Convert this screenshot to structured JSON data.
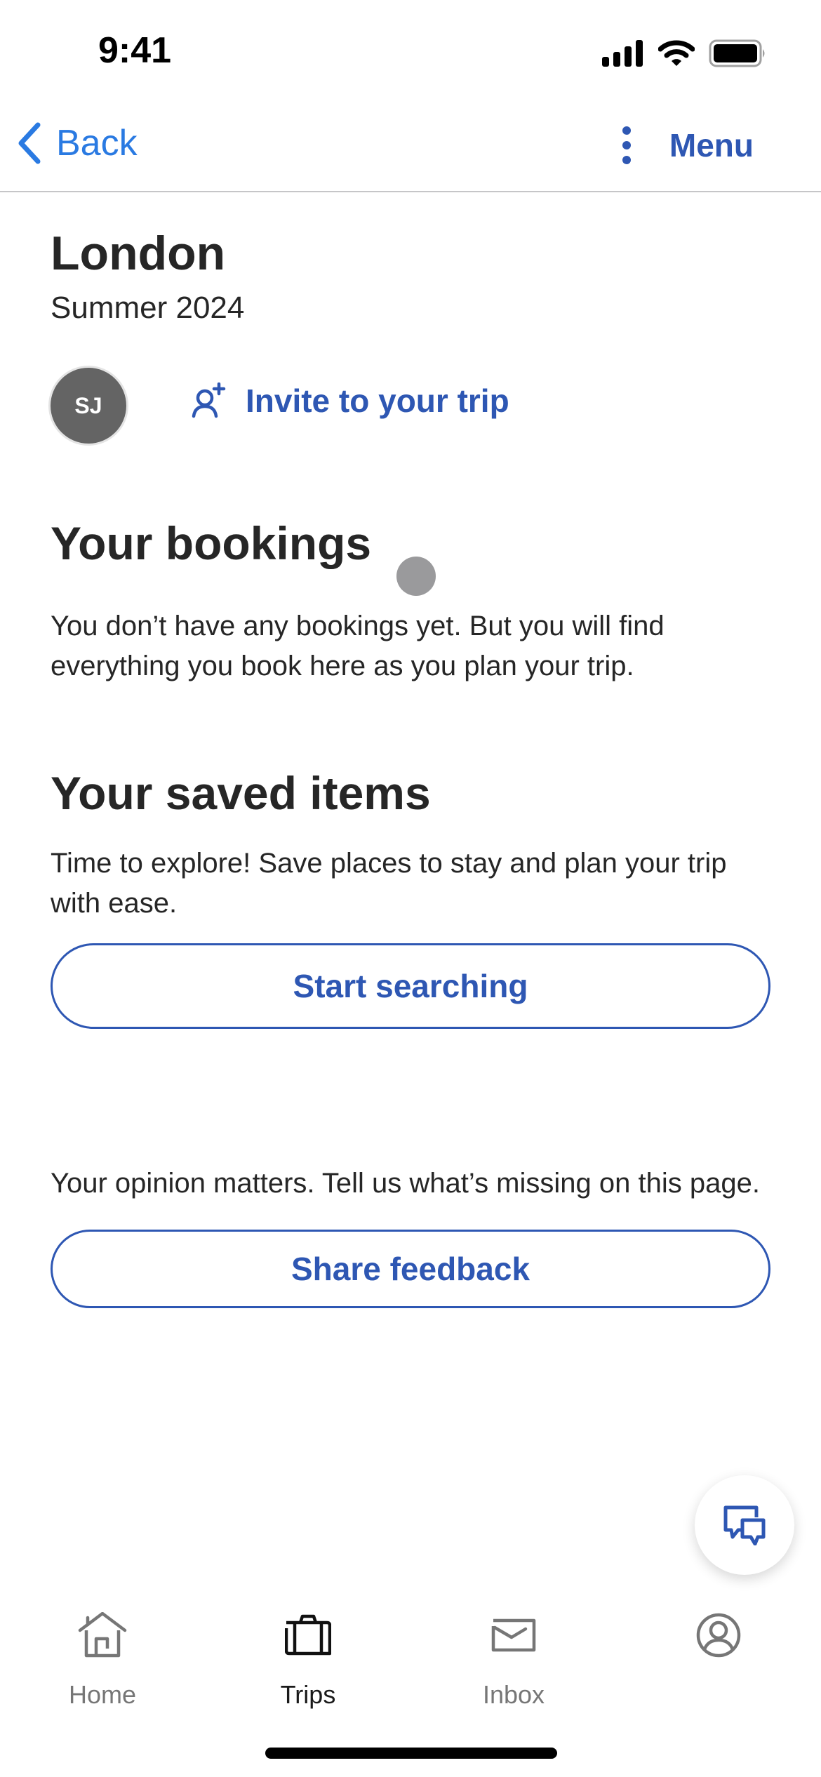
{
  "status_bar": {
    "time": "9:41",
    "icons": [
      "cellular-signal-icon",
      "wifi-icon",
      "battery-icon"
    ]
  },
  "nav": {
    "back_label": "Back",
    "menu_label": "Menu",
    "back_icon": "chevron-left-icon",
    "menu_icon": "more-vertical-icon"
  },
  "trip": {
    "title": "London",
    "subtitle": "Summer 2024",
    "avatar_initials": "SJ",
    "invite_label": "Invite to your trip",
    "invite_icon": "add-person-icon"
  },
  "bookings": {
    "heading": "Your bookings",
    "text": "You don’t have any bookings yet. But you will find everything you book here as you plan your trip."
  },
  "saved": {
    "heading": "Your saved items",
    "text": "Time to explore! Save places to stay and plan your trip with ease.",
    "button_label": "Start searching"
  },
  "feedback": {
    "text": "Your opinion matters. Tell us what’s missing on this page.",
    "button_label": "Share feedback"
  },
  "fab": {
    "icon": "chat-bubbles-icon"
  },
  "tab_bar": {
    "active": "Trips",
    "tabs": [
      {
        "label": "Home",
        "icon": "home-icon"
      },
      {
        "label": "Trips",
        "icon": "suitcase-icon"
      },
      {
        "label": "Inbox",
        "icon": "mail-icon"
      },
      {
        "label": "",
        "icon": "profile-icon"
      }
    ]
  },
  "colors": {
    "brand_blue": "#2e57b3",
    "ios_link_blue": "#2a7ae2",
    "text_primary": "#262626",
    "tab_inactive": "#767676",
    "avatar_bg": "#646464"
  }
}
